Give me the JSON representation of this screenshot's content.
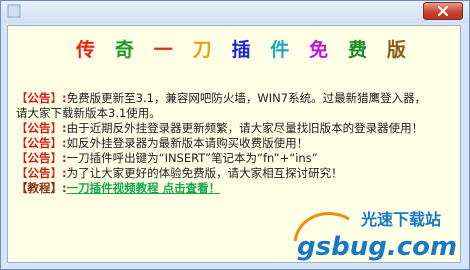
{
  "window": {
    "close_icon": "close-icon",
    "app_icon": "app-icon"
  },
  "banner": {
    "chars": [
      {
        "text": "传",
        "color": "#e8231f"
      },
      {
        "text": "奇",
        "color": "#1a9b2c"
      },
      {
        "text": "一",
        "color": "#e8231f"
      },
      {
        "text": "刀",
        "color": "#e8a20f"
      },
      {
        "text": "插",
        "color": "#1a2ad6"
      },
      {
        "text": "件",
        "color": "#1aa8c8"
      },
      {
        "text": "免",
        "color": "#b81ad6"
      },
      {
        "text": "费",
        "color": "#1a8c2a"
      },
      {
        "text": "版",
        "color": "#8b5a1a"
      }
    ]
  },
  "notices": [
    {
      "bracket_open": "【",
      "tag": "公告",
      "bracket_close": "】",
      "colon": ":",
      "text": "免费版更新至3.1，兼容网吧防火墙，WIN7系统。过最新猎鹰登入器，"
    },
    {
      "continuation": "请大家下载新版本3.1使用。"
    },
    {
      "bracket_open": "【",
      "tag": "公告",
      "bracket_close": "】",
      "colon": ":",
      "text": "由于近期反外挂登录器更新频繁，请大家尽量找旧版本的登录器使用！"
    },
    {
      "bracket_open": "【",
      "tag": "公告",
      "bracket_close": "】",
      "colon": ":",
      "text": "如反外挂登录器为最新版本请购买收费版使用！"
    },
    {
      "bracket_open": "【",
      "tag": "公告",
      "bracket_close": "】",
      "colon": ":",
      "text": "一刀插件呼出键为“INSERT”笔记本为“fn”+“ins”"
    },
    {
      "bracket_open": "【",
      "tag": "公告",
      "bracket_close": "】",
      "colon": ":",
      "text": "为了让大家更好的体验免费版，请大家相互探讨研究！"
    },
    {
      "bracket_open": "【",
      "tag": "教程",
      "bracket_close": "】",
      "colon": ":",
      "link": "一刀插件视频教程 点击查看！"
    }
  ],
  "watermark": {
    "top_text": "光速下载站",
    "bottom_text": "gsbug.com"
  }
}
